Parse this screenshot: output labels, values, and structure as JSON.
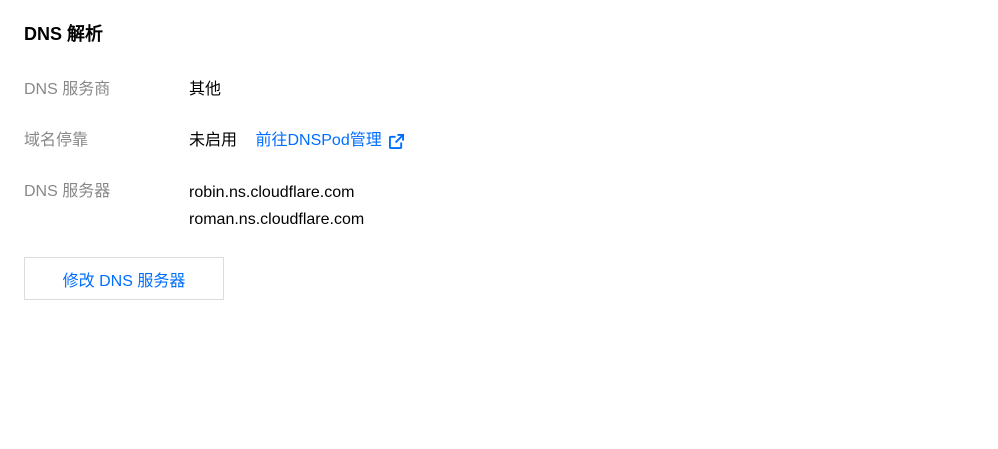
{
  "section": {
    "title": "DNS 解析"
  },
  "rows": {
    "provider": {
      "label": "DNS 服务商",
      "value": "其他"
    },
    "parking": {
      "label": "域名停靠",
      "value": "未启用",
      "link_text": "前往DNSPod管理"
    },
    "servers": {
      "label": "DNS 服务器",
      "values": [
        "robin.ns.cloudflare.com",
        "roman.ns.cloudflare.com"
      ]
    }
  },
  "actions": {
    "modify_dns_label": "修改 DNS 服务器"
  },
  "icons": {
    "external_link": "external-link-icon"
  },
  "colors": {
    "accent": "#006eff",
    "label_gray": "#888888",
    "border": "#dcdcdc"
  }
}
